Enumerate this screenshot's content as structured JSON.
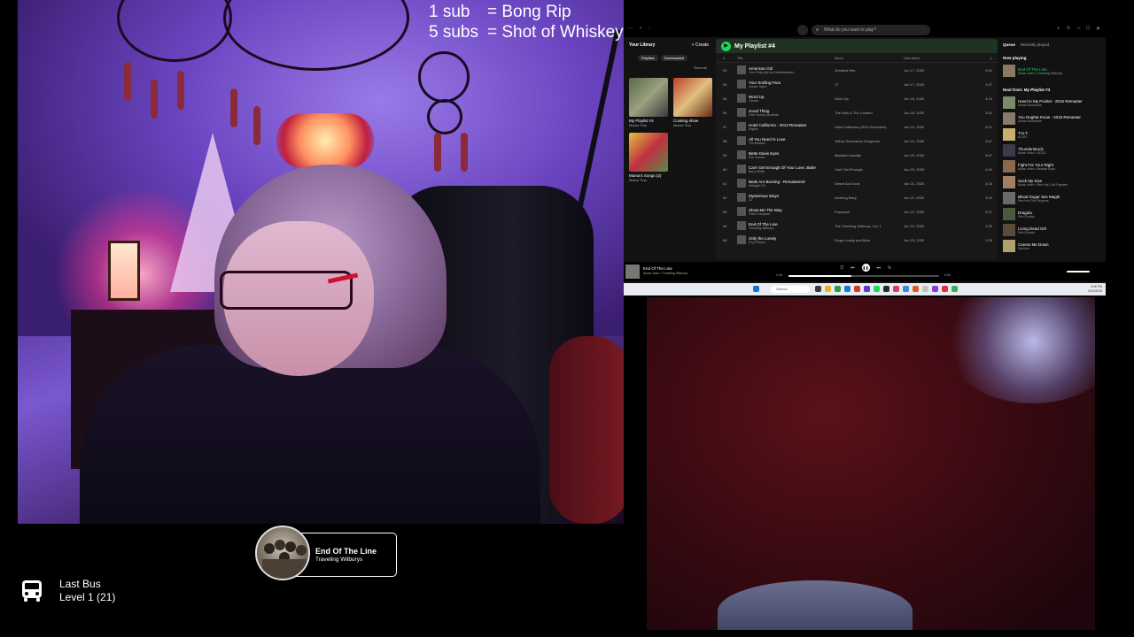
{
  "sub_alerts": [
    {
      "count": "1 sub",
      "reward": "= Bong Rip"
    },
    {
      "count": "5 subs",
      "reward": "= Shot of Whiskey"
    }
  ],
  "spotify": {
    "search_placeholder": "What do you want to play?",
    "library": {
      "title": "Your Library",
      "create_label": "+ Create",
      "chips": [
        "Playlists",
        "Downloaded"
      ],
      "sort_label": "Recents",
      "playlists": [
        {
          "name": "My Playlist #4",
          "owner": "Mama Tina",
          "color": "#6a7a5a"
        },
        {
          "name": "Cooking show",
          "owner": "Mama Tina",
          "color": "#b0423a"
        },
        {
          "name": "Mama's Songs (2)",
          "owner": "Mama Tina",
          "color": "#c8a040"
        }
      ]
    },
    "playlist": {
      "title": "My Playlist #4",
      "columns": [
        "#",
        "Title",
        "Album",
        "Date added",
        "◷"
      ],
      "tracks": [
        {
          "num": "53",
          "title": "American Girl",
          "artist": "Tom Petty and the Heartbreakers",
          "album": "Greatest Hits",
          "date": "Jun 17, 2025",
          "dur": "3:34"
        },
        {
          "num": "54",
          "title": "Your Smiling Face",
          "artist": "James Taylor",
          "album": "JT",
          "date": "Jun 17, 2025",
          "dur": "2:47"
        },
        {
          "num": "55",
          "title": "Word Up",
          "artist": "Cameo",
          "album": "Word Up",
          "date": "Jun 18, 2025",
          "dur": "4:19"
        },
        {
          "num": "56",
          "title": "Good Thing",
          "artist": "Fine Young Cannibals",
          "album": "The Raw & The Cooked",
          "date": "Jun 18, 2025",
          "dur": "3:22"
        },
        {
          "num": "57",
          "title": "Hotel California - 2013 Remaster",
          "artist": "Eagles",
          "album": "Hotel California (2013 Remaster)",
          "date": "Jun 19, 2025",
          "dur": "6:31"
        },
        {
          "num": "58",
          "title": "All You Need Is Love",
          "artist": "The Beatles",
          "album": "Yellow Submarine Songtrack",
          "date": "Jun 19, 2025",
          "dur": "3:47"
        },
        {
          "num": "59",
          "title": "Bette Davis Eyes",
          "artist": "Kim Carnes",
          "album": "Mistaken Identity",
          "date": "Jun 20, 2025",
          "dur": "3:47"
        },
        {
          "num": "60",
          "title": "Can't Get Enough Of Your Love, Babe",
          "artist": "Barry White",
          "album": "Can't Get Enough",
          "date": "Jun 20, 2025",
          "dur": "4:34"
        },
        {
          "num": "61",
          "title": "Beds Are Burning - Remastered",
          "artist": "Midnight Oil",
          "album": "Diesel And Dust",
          "date": "Jun 21, 2025",
          "dur": "4:18"
        },
        {
          "num": "62",
          "title": "Mysterious Ways",
          "artist": "U2",
          "album": "Achtung Baby",
          "date": "Jun 21, 2025",
          "dur": "4:04"
        },
        {
          "num": "63",
          "title": "Show Me The Way",
          "artist": "Peter Frampton",
          "album": "Frampton",
          "date": "Jun 22, 2025",
          "dur": "4:37"
        },
        {
          "num": "64",
          "title": "End Of The Line",
          "artist": "Traveling Wilburys",
          "album": "The Traveling Wilburys, Vol. 1",
          "date": "Jun 22, 2025",
          "dur": "3:30"
        },
        {
          "num": "65",
          "title": "Only the Lonely",
          "artist": "Roy Orbison",
          "album": "Sings Lonely and Blue",
          "date": "Jun 23, 2025",
          "dur": "2:25"
        }
      ]
    },
    "queue": {
      "tabs": [
        "Queue",
        "Recently played"
      ],
      "now_playing_heading": "Now playing",
      "now_playing": {
        "title": "End Of The Line",
        "artist": "Music video • Traveling Wilburys"
      },
      "next_heading": "Next from: My Playlist #3",
      "items": [
        {
          "title": "Hand In My Pocket - 2015 Remaster",
          "artist": "Alanis Morissette",
          "color": "#7a8a6a"
        },
        {
          "title": "You Oughta Know - 2015 Remaster",
          "artist": "Alanis Morissette",
          "color": "#8a7a6a"
        },
        {
          "title": "T.N.T.",
          "artist": "AC/DC",
          "color": "#c8b070"
        },
        {
          "title": "Thunderstruck",
          "artist": "Music video • AC/DC",
          "color": "#3a3a4a"
        },
        {
          "title": "Fight For Your Right",
          "artist": "Music video • Beastie Boys",
          "color": "#8a6a4a"
        },
        {
          "title": "Sock My Kiss",
          "artist": "Music video • Red Hot Chili Peppers",
          "color": "#a08060"
        },
        {
          "title": "Blood Sugar Sex Magik",
          "artist": "Red Hot Chili Peppers",
          "color": "#6a6a6a"
        },
        {
          "title": "Dragula",
          "artist": "Rob Zombie",
          "color": "#4a5a3a"
        },
        {
          "title": "Living Dead Girl",
          "artist": "Rob Zombie",
          "color": "#5a4a3a"
        },
        {
          "title": "Caress Me Down",
          "artist": "Sublime",
          "color": "#b0a070"
        }
      ]
    },
    "player": {
      "title": "End Of The Line",
      "artist": "Music video • Traveling Wilburys",
      "progress": 0.42,
      "time_elapsed": "1:26",
      "time_total": "3:30"
    },
    "taskbar": {
      "search_label": "Search",
      "clock_time": "4:06 PM",
      "clock_date": "6/24/2025"
    }
  },
  "now_playing_widget": {
    "title": "End Of The Line",
    "artist": "Traveling Wilburys"
  },
  "last_bus": {
    "name": "Last Bus",
    "level": "Level 1  (21)"
  },
  "colors": {
    "spotify_green": "#1ed760",
    "background": "#000000"
  }
}
